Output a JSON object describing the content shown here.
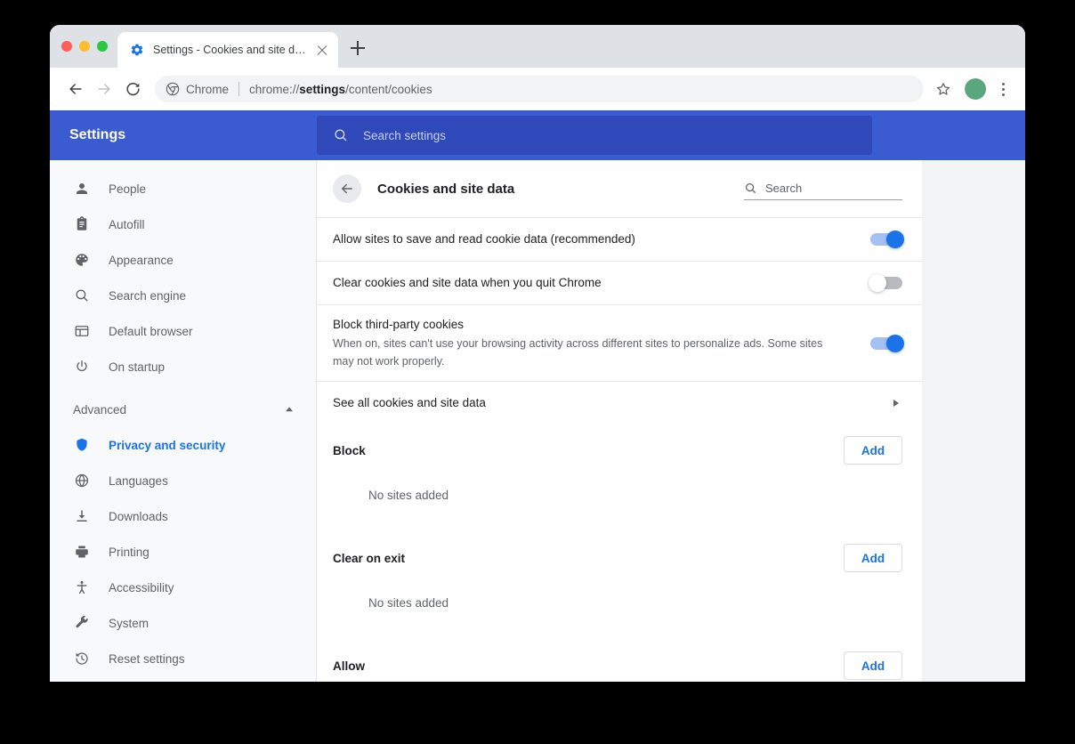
{
  "window": {
    "traffic_lights": [
      "close",
      "minimize",
      "maximize"
    ]
  },
  "tabstrip": {
    "tab": {
      "favicon": "settings-gear-icon",
      "title": "Settings - Cookies and site data",
      "close_icon": "close-icon"
    },
    "new_tab_icon": "plus-icon"
  },
  "toolbar": {
    "back_icon": "arrow-left-icon",
    "forward_icon": "arrow-right-icon",
    "reload_icon": "reload-icon",
    "omnibox": {
      "chip_icon": "chrome-icon",
      "chip_label": "Chrome",
      "url_prefix": "chrome://",
      "url_bold": "settings",
      "url_suffix": "/content/cookies"
    },
    "bookmark_icon": "star-icon",
    "avatar_icon": "profile-avatar",
    "menu_icon": "kebab-menu-icon"
  },
  "settings_header": {
    "title": "Settings",
    "search_icon": "search-icon",
    "search_placeholder": "Search settings"
  },
  "sidebar": {
    "items": [
      {
        "label": "People",
        "icon": "person-icon"
      },
      {
        "label": "Autofill",
        "icon": "clipboard-icon"
      },
      {
        "label": "Appearance",
        "icon": "palette-icon"
      },
      {
        "label": "Search engine",
        "icon": "search-icon"
      },
      {
        "label": "Default browser",
        "icon": "browser-window-icon"
      },
      {
        "label": "On startup",
        "icon": "power-icon"
      }
    ],
    "advanced": {
      "label": "Advanced",
      "caret_icon": "chevron-up-icon",
      "expanded": true,
      "items": [
        {
          "label": "Privacy and security",
          "icon": "shield-icon",
          "active": true
        },
        {
          "label": "Languages",
          "icon": "globe-icon",
          "active": false
        },
        {
          "label": "Downloads",
          "icon": "download-icon",
          "active": false
        },
        {
          "label": "Printing",
          "icon": "printer-icon",
          "active": false
        },
        {
          "label": "Accessibility",
          "icon": "accessibility-icon",
          "active": false
        },
        {
          "label": "System",
          "icon": "wrench-icon",
          "active": false
        },
        {
          "label": "Reset settings",
          "icon": "history-restore-icon",
          "active": false
        }
      ]
    }
  },
  "main": {
    "back_icon": "arrow-left-icon",
    "title": "Cookies and site data",
    "search_icon": "search-icon",
    "search_placeholder": "Search",
    "rows": [
      {
        "label": "Allow sites to save and read cookie data (recommended)",
        "sub": "",
        "control": "toggle",
        "state": "on"
      },
      {
        "label": "Clear cookies and site data when you quit Chrome",
        "sub": "",
        "control": "toggle",
        "state": "off"
      },
      {
        "label": "Block third-party cookies",
        "sub": "When on, sites can't use your browsing activity across different sites to personalize ads. Some sites may not work properly.",
        "control": "toggle",
        "state": "on"
      },
      {
        "label": "See all cookies and site data",
        "sub": "",
        "control": "chevron",
        "state": ""
      }
    ],
    "sections": [
      {
        "title": "Block",
        "add_label": "Add",
        "empty": "No sites added"
      },
      {
        "title": "Clear on exit",
        "add_label": "Add",
        "empty": "No sites added"
      },
      {
        "title": "Allow",
        "add_label": "Add",
        "empty": ""
      }
    ]
  },
  "colors": {
    "settings_header_blue": "#3b5bd0",
    "settings_search_blue": "#2f49bb",
    "accent_blue": "#1a73e8",
    "toggle_on_track": "#a4c0f4",
    "toggle_off_track": "#b7bbbf",
    "page_bg": "#f1f3f4",
    "sidebar_bg": "#f8f9fa"
  }
}
